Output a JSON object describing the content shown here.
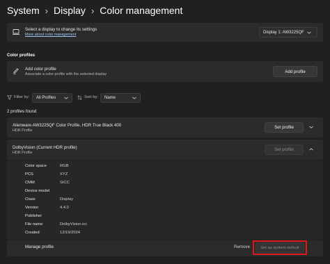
{
  "breadcrumb": [
    "System",
    "Display",
    "Color management"
  ],
  "display_select": {
    "title": "Select a display to change its settings",
    "link": "More about color management",
    "value": "Display 1: AW3225QF"
  },
  "section_title": "Color profiles",
  "add_profile": {
    "title": "Add color profile",
    "subtitle": "Associate a color profile with the selected display",
    "button": "Add profile"
  },
  "filters": {
    "filter_label": "Filter by:",
    "filter_value": "All Profiles",
    "sort_label": "Sort by:",
    "sort_value": "Name"
  },
  "found_count": "2 profiles found",
  "profiles": [
    {
      "title": "Alienware AW3225QF Color Profile, HDR True Black 400",
      "type": "HDR Profile",
      "button": "Set profile"
    },
    {
      "title": "DolbyVision (Current HDR profile)",
      "type": "HDR Profile",
      "button": "Set profile",
      "properties": [
        {
          "key": "Color space",
          "value": "RGB"
        },
        {
          "key": "PCS",
          "value": "XYZ"
        },
        {
          "key": "CMM",
          "value": "SICC"
        },
        {
          "key": "Device model",
          "value": ""
        },
        {
          "key": "Class",
          "value": "Display"
        },
        {
          "key": "Version",
          "value": "4.4.0"
        },
        {
          "key": "Publisher",
          "value": ""
        },
        {
          "key": "File name",
          "value": "DolbyVision.icc"
        },
        {
          "key": "Created",
          "value": "12/19/2024"
        }
      ],
      "manage_label": "Manage profile",
      "remove_label": "Remove",
      "default_button": "Set as system default"
    }
  ],
  "colors": {
    "background": "#202020",
    "card": "#2b2b2b",
    "link": "#9fc6f0",
    "highlight": "#e0191b"
  },
  "icons": [
    "monitor-icon",
    "pen-add-icon",
    "filter-icon",
    "sort-icon",
    "chevron-down-icon",
    "chevron-up-icon"
  ]
}
